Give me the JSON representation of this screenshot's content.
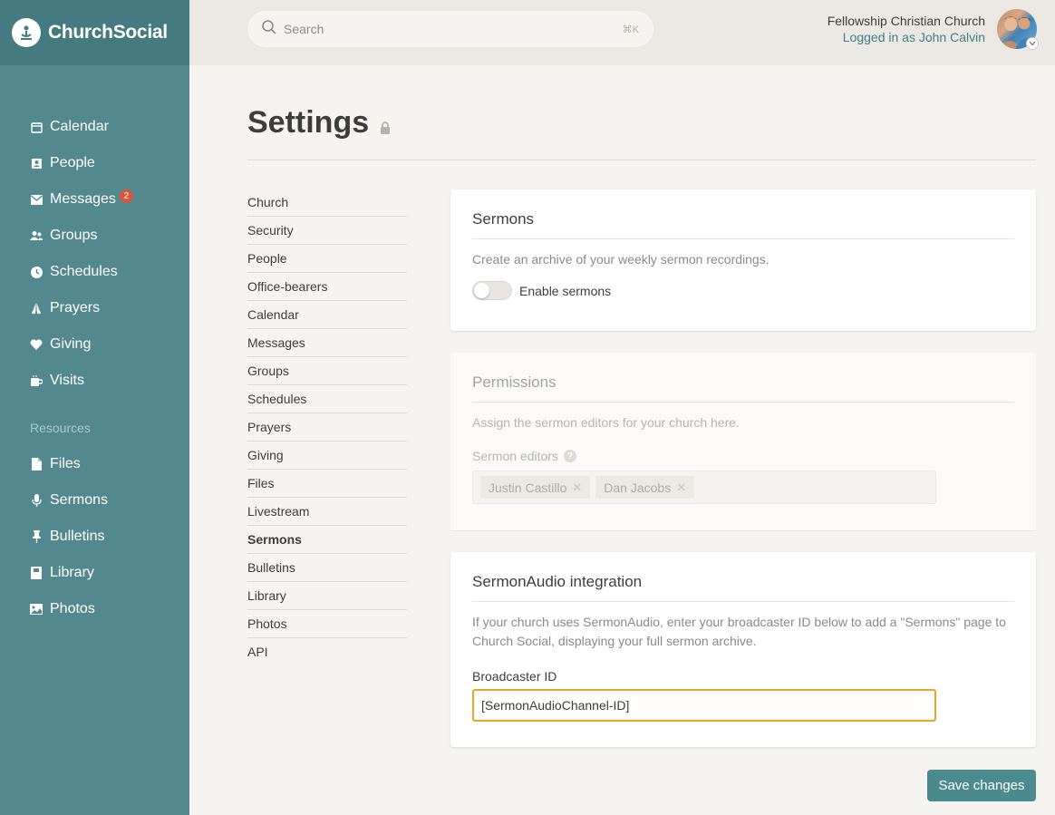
{
  "app": {
    "name": "ChurchSocial"
  },
  "search": {
    "placeholder": "Search",
    "shortcut": "⌘K"
  },
  "account": {
    "church_name": "Fellowship Christian Church",
    "logged_in_text": "Logged in as John Calvin"
  },
  "sidebar": {
    "items": [
      {
        "label": "Calendar",
        "icon": "calendar-icon"
      },
      {
        "label": "People",
        "icon": "people-icon"
      },
      {
        "label": "Messages",
        "icon": "mail-icon",
        "badge": "2"
      },
      {
        "label": "Groups",
        "icon": "groups-icon"
      },
      {
        "label": "Schedules",
        "icon": "clock-icon"
      },
      {
        "label": "Prayers",
        "icon": "praying-hands-icon"
      },
      {
        "label": "Giving",
        "icon": "heart-icon"
      },
      {
        "label": "Visits",
        "icon": "coffee-cup-icon"
      }
    ],
    "resources_label": "Resources",
    "resources": [
      {
        "label": "Files",
        "icon": "file-icon"
      },
      {
        "label": "Sermons",
        "icon": "microphone-icon"
      },
      {
        "label": "Bulletins",
        "icon": "pin-icon"
      },
      {
        "label": "Library",
        "icon": "book-icon"
      },
      {
        "label": "Photos",
        "icon": "photo-icon"
      }
    ]
  },
  "page": {
    "title": "Settings",
    "title_icon": "lock-icon"
  },
  "settings_nav": {
    "active": "Sermons",
    "items": [
      "Church",
      "Security",
      "People",
      "Office-bearers",
      "Calendar",
      "Messages",
      "Groups",
      "Schedules",
      "Prayers",
      "Giving",
      "Files",
      "Livestream",
      "Sermons",
      "Bulletins",
      "Library",
      "Photos",
      "API"
    ]
  },
  "sermons_card": {
    "title": "Sermons",
    "description": "Create an archive of your weekly sermon recordings.",
    "toggle_label": "Enable sermons",
    "toggle_on": false
  },
  "permissions_card": {
    "title": "Permissions",
    "description": "Assign the sermon editors for your church here.",
    "field_label": "Sermon editors",
    "editors": [
      "Justin Castillo",
      "Dan Jacobs"
    ]
  },
  "sermonaudio_card": {
    "title": "SermonAudio integration",
    "description": "If your church uses SermonAudio, enter your broadcaster ID below to add a \"Sermons\" page to Church Social, displaying your full sermon archive.",
    "field_label": "Broadcaster ID",
    "field_value": "[SermonAudioChannel-ID]"
  },
  "actions": {
    "save_label": "Save changes"
  },
  "colors": {
    "sidebar": "#53888e",
    "sidebar_header": "#457a80",
    "accent": "#4b8a8e",
    "focus": "#e6a52d",
    "badge": "#d9563d"
  }
}
